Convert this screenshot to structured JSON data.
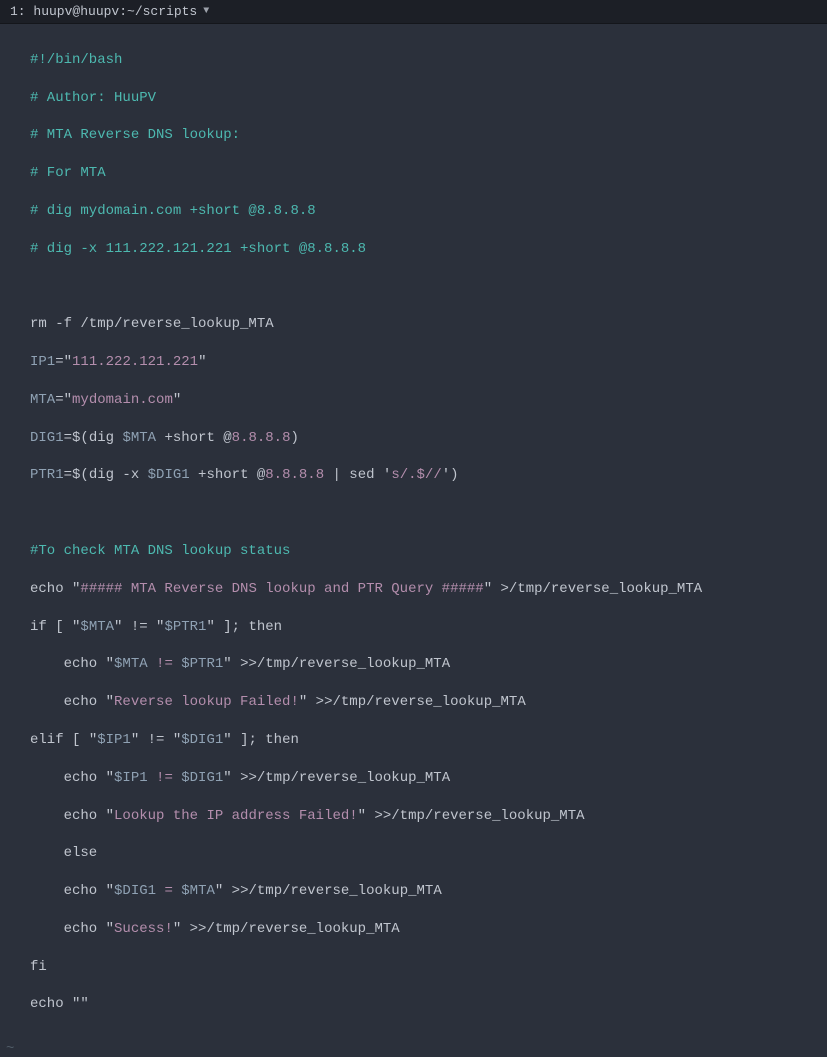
{
  "titlebar": {
    "label": "1: huupv@huupv:~/scripts"
  },
  "code": {
    "l1_shebang": "#!/bin/bash",
    "l2_author": "# Author: HuuPV",
    "l3_mta": "# MTA Reverse DNS lookup:",
    "l4_for": "# For MTA",
    "l5_dig1": "# dig mydomain.com +short @8.8.8.8",
    "l6_dig2": "# dig -x 111.222.121.221 +short @8.8.8.8",
    "l8_rm": "rm -f /tmp/reverse_lookup_MTA",
    "l9_ip1_var": "IP1",
    "l9_eq": "=",
    "l9_q": "\"",
    "l9_val": "111.222.121.221",
    "l10_var": "MTA",
    "l10_val": "mydomain.com",
    "l11_var": "DIG1",
    "l11_dollar": "=$(",
    "l11_dig": "dig ",
    "l11_mta": "$MTA",
    "l11_short": " +short @",
    "l11_dns": "8.8.8.8",
    "l11_close": ")",
    "l12_var": "PTR1",
    "l12_dig": "dig -x ",
    "l12_dig1": "$DIG1",
    "l12_short": " +short @",
    "l12_dns": "8.8.8.8",
    "l12_pipe": " | sed ",
    "l12_sedq": "'",
    "l12_sed": "s/.$//",
    "l12_close2": ")",
    "l14_comment": "#To check MTA DNS lookup status",
    "l15_echo": "echo ",
    "l15_str1": "##### MTA Reverse DNS lookup and PTR Query #####",
    "l15_out": " >/tmp/reverse_lookup_MTA",
    "l16_if": "if [ ",
    "l16_q": "\"",
    "l16_mta": "$MTA",
    "l16_ne": " != ",
    "l16_ptr": "$PTR1",
    "l16_then": " ]; then",
    "l17_indent": "    echo ",
    "l17_mta": "$MTA",
    "l17_ne": " != ",
    "l17_ptr": "$PTR1",
    "l17_out": " >>/tmp/reverse_lookup_MTA",
    "l18_str": "Reverse lookup Failed!",
    "l18_out": " >>/tmp/reverse_lookup_MTA",
    "l19_elif": "elif [ ",
    "l19_ip1": "$IP1",
    "l19_dig1": "$DIG1",
    "l20_out": " >>/tmp/reverse_lookup_MTA",
    "l21_str": "Lookup the IP address Failed!",
    "l21_out": " >>/tmp/reverse_lookup_MTA",
    "l22_else": "    else",
    "l23_eq": " = ",
    "l23_out": " >>/tmp/reverse_lookup_MTA",
    "l24_str": "Sucess!",
    "l24_out": " >>/tmp/reverse_lookup_MTA",
    "l25_fi": "fi",
    "l26_echo": "echo ",
    "l26_empty": "\"\"",
    "tilde": "~"
  }
}
